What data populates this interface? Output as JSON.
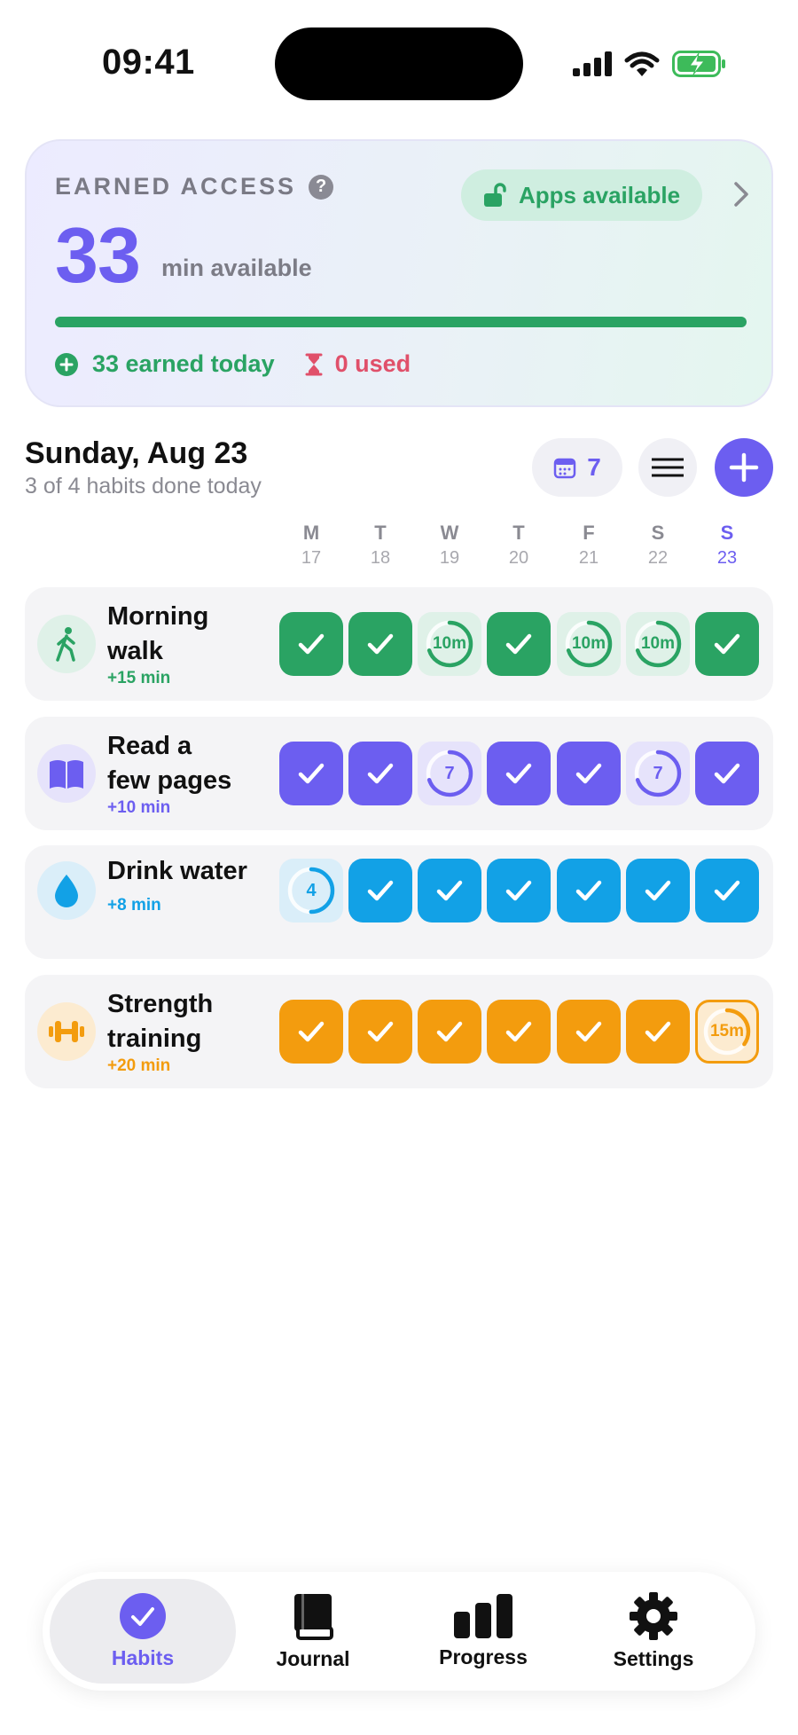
{
  "status_bar": {
    "time": "09:41"
  },
  "access": {
    "title": "EARNED ACCESS",
    "help_icon": "question-icon",
    "apps_status": "Apps available",
    "minutes": "33",
    "minutes_label": "min available",
    "progress_fraction": 1.0,
    "earned_today": "33 earned today",
    "used": "0 used",
    "accent": "#6c5ef0",
    "green": "#2aa363",
    "red": "#e0506a"
  },
  "header": {
    "date": "Sunday, Aug 23",
    "summary": "3 of 4 habits done today",
    "streak_count": "7"
  },
  "days": [
    {
      "letter": "M",
      "num": "17"
    },
    {
      "letter": "T",
      "num": "18"
    },
    {
      "letter": "W",
      "num": "19"
    },
    {
      "letter": "T",
      "num": "20"
    },
    {
      "letter": "F",
      "num": "21"
    },
    {
      "letter": "S",
      "num": "22"
    },
    {
      "letter": "S",
      "num": "23"
    }
  ],
  "habits": [
    {
      "name": "Morning walk",
      "name_line1": "Morning",
      "name_line2": "walk",
      "reward": "+15 min",
      "icon": "walk-icon",
      "color": "#2aa363",
      "light": "#dff1e8",
      "days": [
        {
          "state": "done"
        },
        {
          "state": "done"
        },
        {
          "state": "partial",
          "label": "10m",
          "fraction": 0.7
        },
        {
          "state": "done"
        },
        {
          "state": "partial",
          "label": "10m",
          "fraction": 0.7
        },
        {
          "state": "partial",
          "label": "10m",
          "fraction": 0.7
        },
        {
          "state": "done"
        }
      ]
    },
    {
      "name": "Read a few pages",
      "name_line1": "Read a",
      "name_line2": "few pages",
      "reward": "+10 min",
      "icon": "book-icon",
      "color": "#6c5ef0",
      "light": "#e6e3fb",
      "days": [
        {
          "state": "done"
        },
        {
          "state": "done"
        },
        {
          "state": "partial",
          "label": "7",
          "fraction": 0.7
        },
        {
          "state": "done"
        },
        {
          "state": "done"
        },
        {
          "state": "partial",
          "label": "7",
          "fraction": 0.7
        },
        {
          "state": "done"
        }
      ]
    },
    {
      "name": "Drink water",
      "name_line1": "Drink water",
      "name_line2": "",
      "reward": "+8 min",
      "icon": "water-drop-icon",
      "color": "#12a1e6",
      "light": "#daeef9",
      "days": [
        {
          "state": "partial",
          "label": "4",
          "fraction": 0.5
        },
        {
          "state": "done"
        },
        {
          "state": "done"
        },
        {
          "state": "done"
        },
        {
          "state": "done"
        },
        {
          "state": "done"
        },
        {
          "state": "done"
        }
      ]
    },
    {
      "name": "Strength training",
      "name_line1": "Strength",
      "name_line2": "training",
      "reward": "+20 min",
      "icon": "dumbbell-icon",
      "color": "#f39c0e",
      "light": "#fcebd0",
      "days": [
        {
          "state": "done"
        },
        {
          "state": "done"
        },
        {
          "state": "done"
        },
        {
          "state": "done"
        },
        {
          "state": "done"
        },
        {
          "state": "done"
        },
        {
          "state": "today-partial",
          "label": "15m",
          "fraction": 0.35
        }
      ]
    }
  ],
  "tabs": [
    {
      "label": "Habits",
      "icon": "checkmark-circle-icon",
      "active": true
    },
    {
      "label": "Journal",
      "icon": "journal-book-icon",
      "active": false
    },
    {
      "label": "Progress",
      "icon": "bar-chart-icon",
      "active": false
    },
    {
      "label": "Settings",
      "icon": "gear-icon",
      "active": false
    }
  ]
}
